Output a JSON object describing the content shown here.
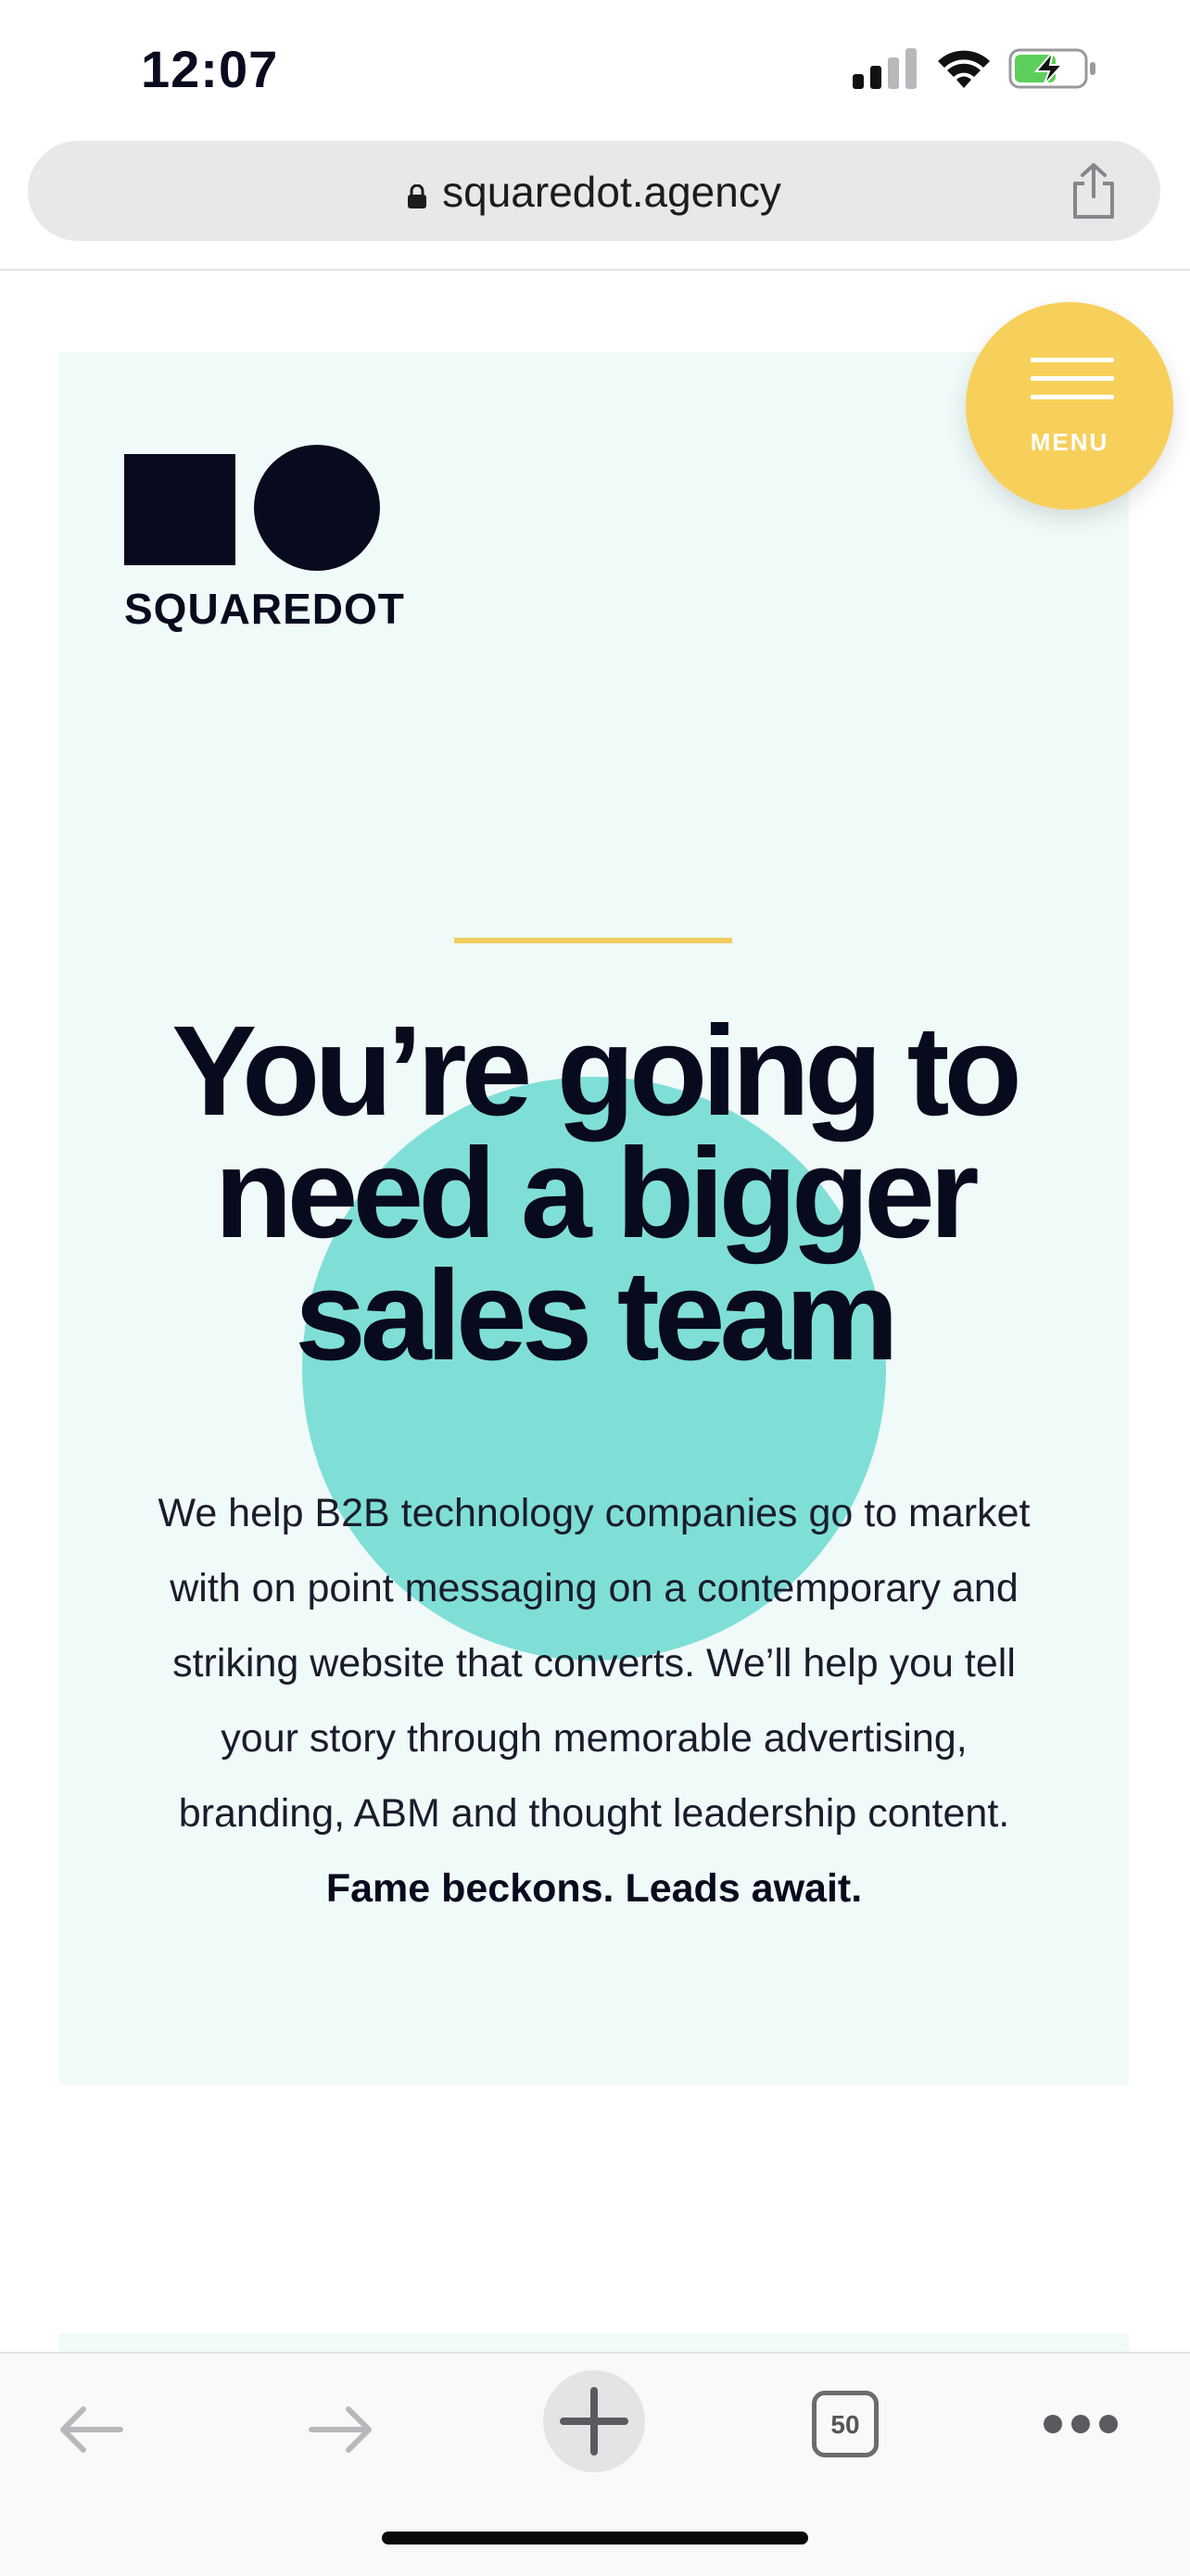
{
  "status_bar": {
    "time": "12:07",
    "signal_icon": "cellular-signal-icon",
    "wifi_icon": "wifi-icon",
    "battery_icon": "battery-charging-icon"
  },
  "browser": {
    "url": "squaredot.agency",
    "lock_icon": "lock-icon",
    "share_icon": "share-icon",
    "tab_count": "50"
  },
  "site": {
    "logo_text": "SQUAREDOT",
    "menu_label": "MENU",
    "headline_lines": [
      "You’re going to",
      "need a bigger",
      "sales team"
    ],
    "body_lines": [
      "We help B2B technology companies go to market",
      "with on point messaging on a contemporary and",
      "striking website that converts. We’ll help you tell",
      "your story through memorable advertising,",
      "branding, ABM and thought leadership content."
    ],
    "tagline": "Fame beckons. Leads await."
  },
  "colors": {
    "hero_background": "#f0faf8",
    "accent_yellow": "#f7d05c",
    "teal_circle": "#7fdfd6",
    "navy_text": "#080a1e"
  }
}
